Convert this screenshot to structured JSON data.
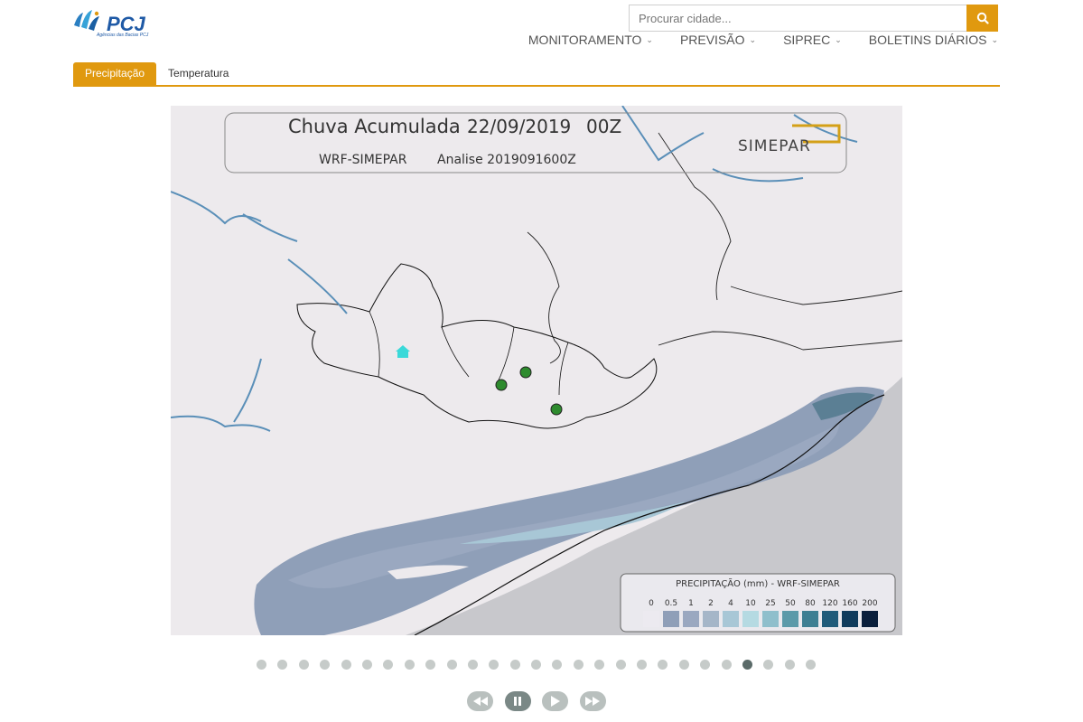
{
  "header": {
    "logo_text": "PCJ",
    "logo_caption": "Agências das Bacias PCJ",
    "search": {
      "placeholder": "Procurar cidade...",
      "value": ""
    },
    "search_icon": "search-icon",
    "brand_color": "#e0990f"
  },
  "nav": {
    "items": [
      {
        "label": "MONITORAMENTO"
      },
      {
        "label": "PREVISÃO"
      },
      {
        "label": "SIPREC"
      },
      {
        "label": "BOLETINS DIÁRIOS"
      }
    ]
  },
  "tabs": [
    {
      "label": "Precipitação",
      "active": true
    },
    {
      "label": "Temperatura",
      "active": false
    }
  ],
  "map": {
    "title": "Chuva Acumulada",
    "date": "22/09/2019",
    "hour": "00Z",
    "model": "WRF-SIMEPAR",
    "analysis": "Analise 2019091600Z",
    "brand": "SIMEPAR",
    "legend": {
      "title": "PRECIPITAÇÃO (mm) - WRF-SIMEPAR",
      "values": [
        "0",
        "0.5",
        "1",
        "2",
        "4",
        "10",
        "25",
        "50",
        "80",
        "120",
        "160",
        "200"
      ],
      "colors": [
        "#eceaf0",
        "#8f9fb8",
        "#9aa8c0",
        "#a5b6c8",
        "#a8c7d6",
        "#b5dae2",
        "#8fbfcc",
        "#5b9aa9",
        "#3d7f93",
        "#1f5b7a",
        "#0f3b5c",
        "#0a1f3c"
      ]
    }
  },
  "slider": {
    "total": 27,
    "active_index": 23
  },
  "controls": [
    {
      "name": "rewind-icon"
    },
    {
      "name": "pause-icon"
    },
    {
      "name": "play-icon"
    },
    {
      "name": "fast-forward-icon"
    }
  ]
}
